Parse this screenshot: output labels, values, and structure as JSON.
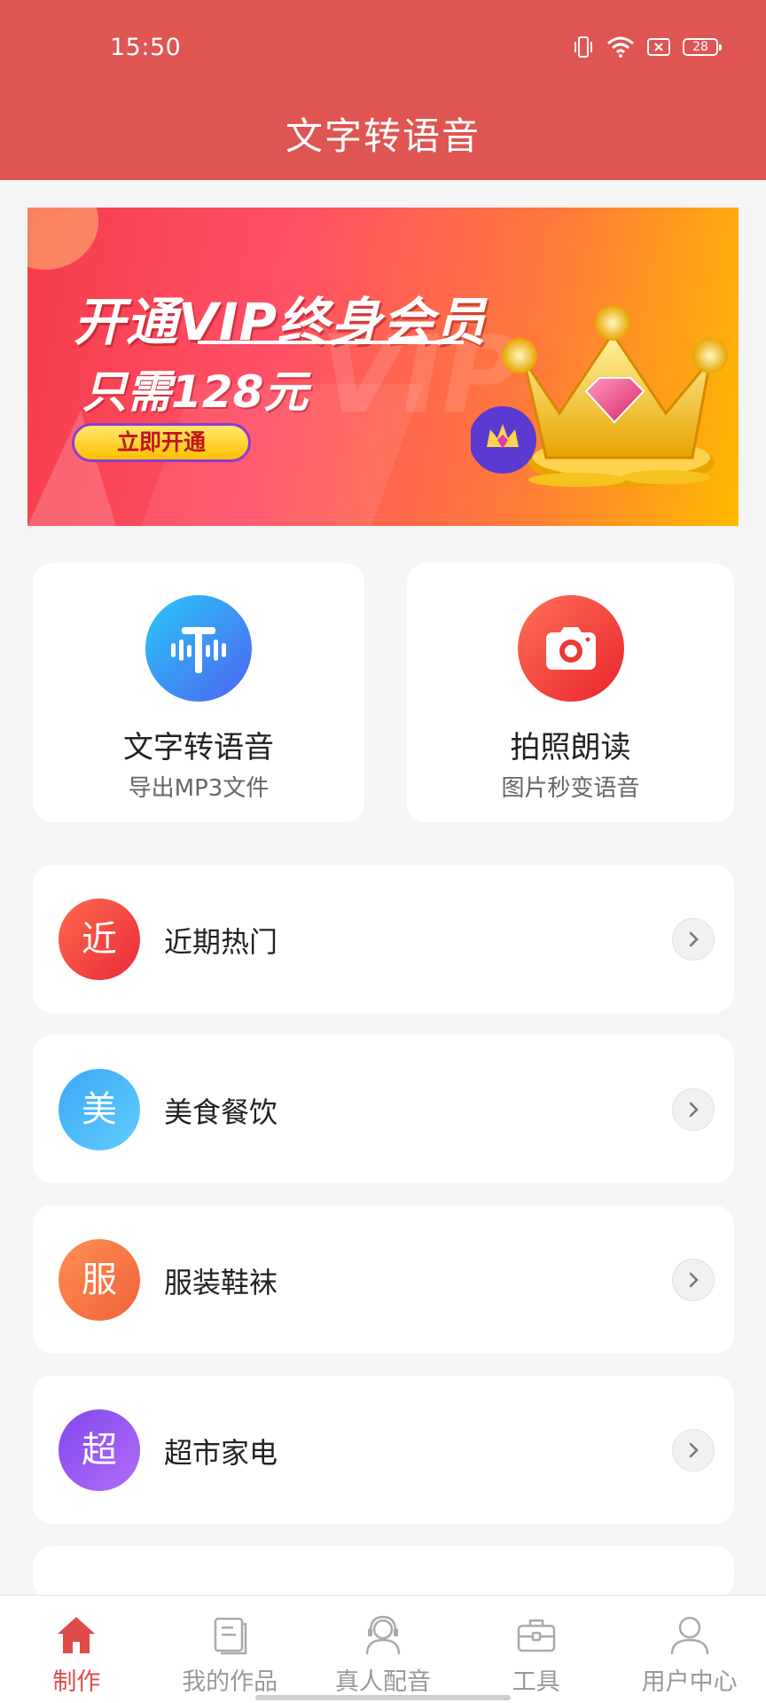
{
  "status_bar": {
    "time": "15:50",
    "battery": "28",
    "icons": [
      "vibrate-icon",
      "wifi-icon",
      "sim-icon",
      "battery-icon"
    ]
  },
  "header": {
    "title": "文字转语音"
  },
  "banner": {
    "headline": "开通VIP终身会员",
    "price_text": "只需128元",
    "button": "立即开通",
    "watermark": "VIP"
  },
  "features": [
    {
      "title": "文字转语音",
      "subtitle": "导出MP3文件",
      "icon": "audio-text-icon"
    },
    {
      "title": "拍照朗读",
      "subtitle": "图片秒变语音",
      "icon": "camera-icon"
    }
  ],
  "categories": [
    {
      "avatar": "近",
      "label": "近期热门",
      "color_from": "#ff6a4d",
      "color_to": "#ea2a3a"
    },
    {
      "avatar": "美",
      "label": "美食餐饮",
      "color_from": "#35b6f7",
      "color_to": "#5cc7ff"
    },
    {
      "avatar": "服",
      "label": "服装鞋袜",
      "color_from": "#ff8a4f",
      "color_to": "#f46a3a"
    },
    {
      "avatar": "超",
      "label": "超市家电",
      "color_from": "#8a52f0",
      "color_to": "#b06af8"
    }
  ],
  "bottom_nav": [
    {
      "label": "制作",
      "icon": "home-icon",
      "active": true
    },
    {
      "label": "我的作品",
      "icon": "document-icon",
      "active": false
    },
    {
      "label": "真人配音",
      "icon": "voice-actor-icon",
      "active": false
    },
    {
      "label": "工具",
      "icon": "toolbox-icon",
      "active": false
    },
    {
      "label": "用户中心",
      "icon": "user-icon",
      "active": false
    }
  ],
  "colors": {
    "primary": "#df5552",
    "active_tab": "#df4b47"
  }
}
